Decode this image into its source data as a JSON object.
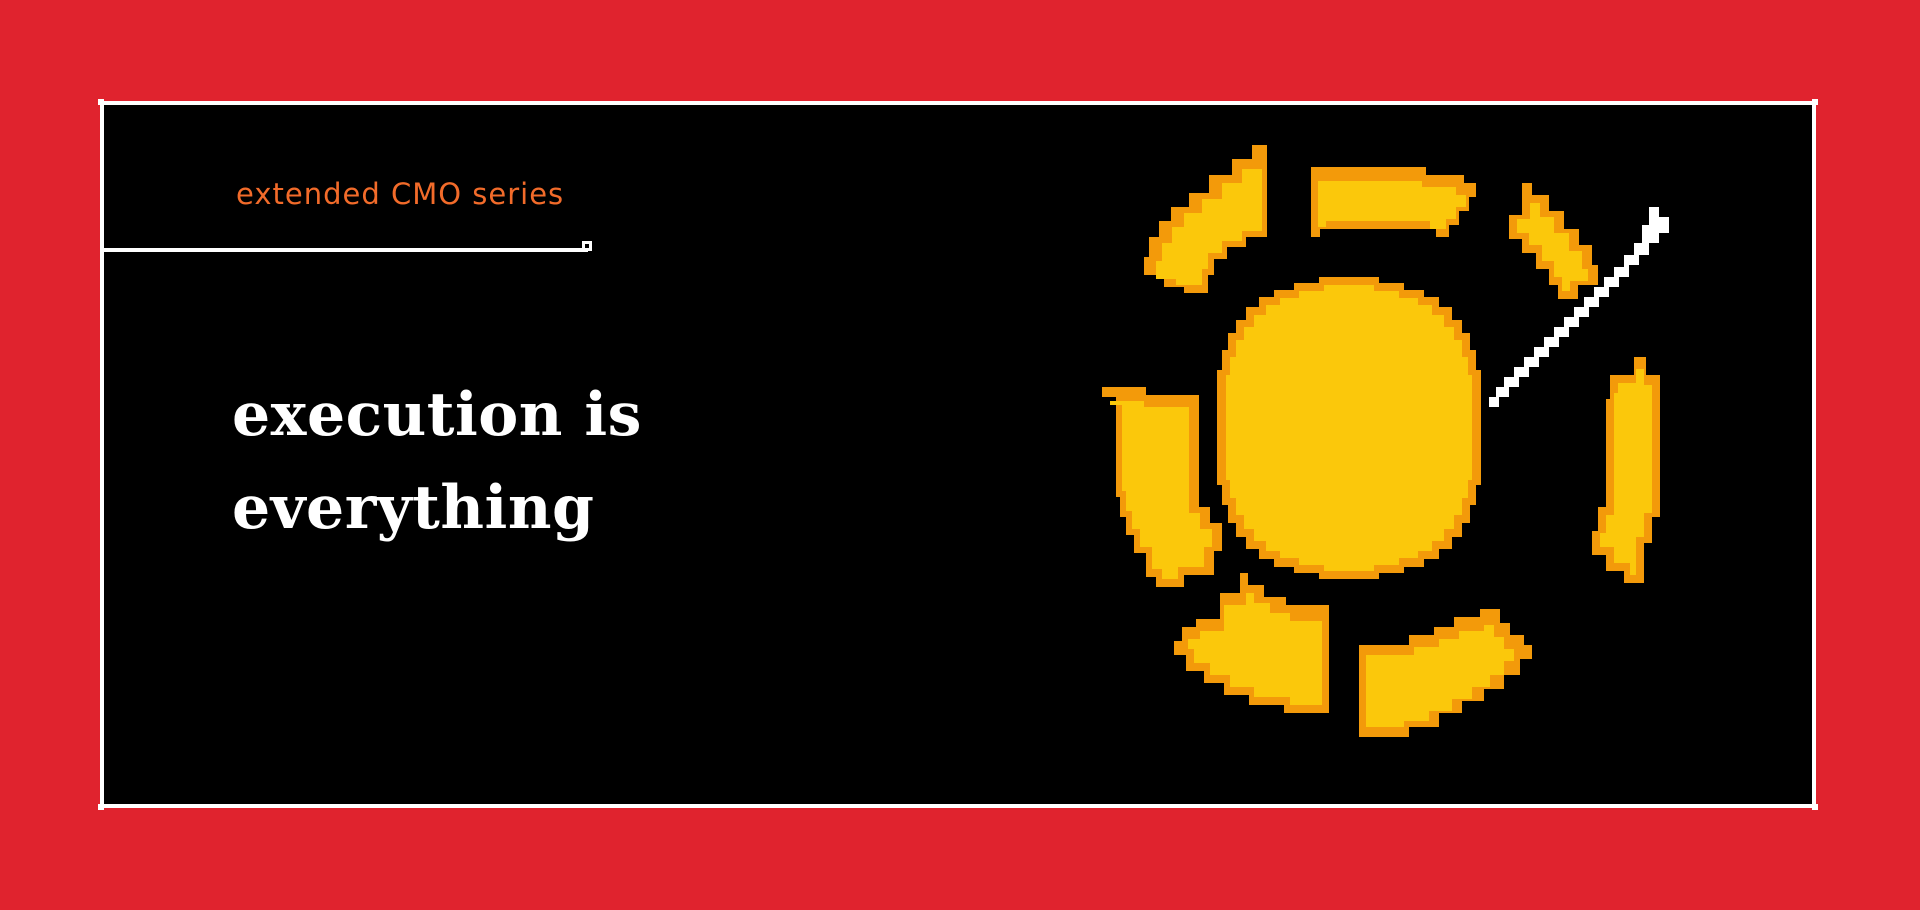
{
  "card": {
    "series_label": "extended CMO series",
    "headline_line1": "execution is",
    "headline_line2": "everything"
  },
  "colors": {
    "background": "#e0232e",
    "card": "#000000",
    "accent": "#f26b2a",
    "sun_fill": "#fbc80b",
    "sun_outline": "#f39a0a",
    "text": "#ffffff"
  },
  "illustration": {
    "icon": "pixel-sun-with-pen-icon"
  }
}
